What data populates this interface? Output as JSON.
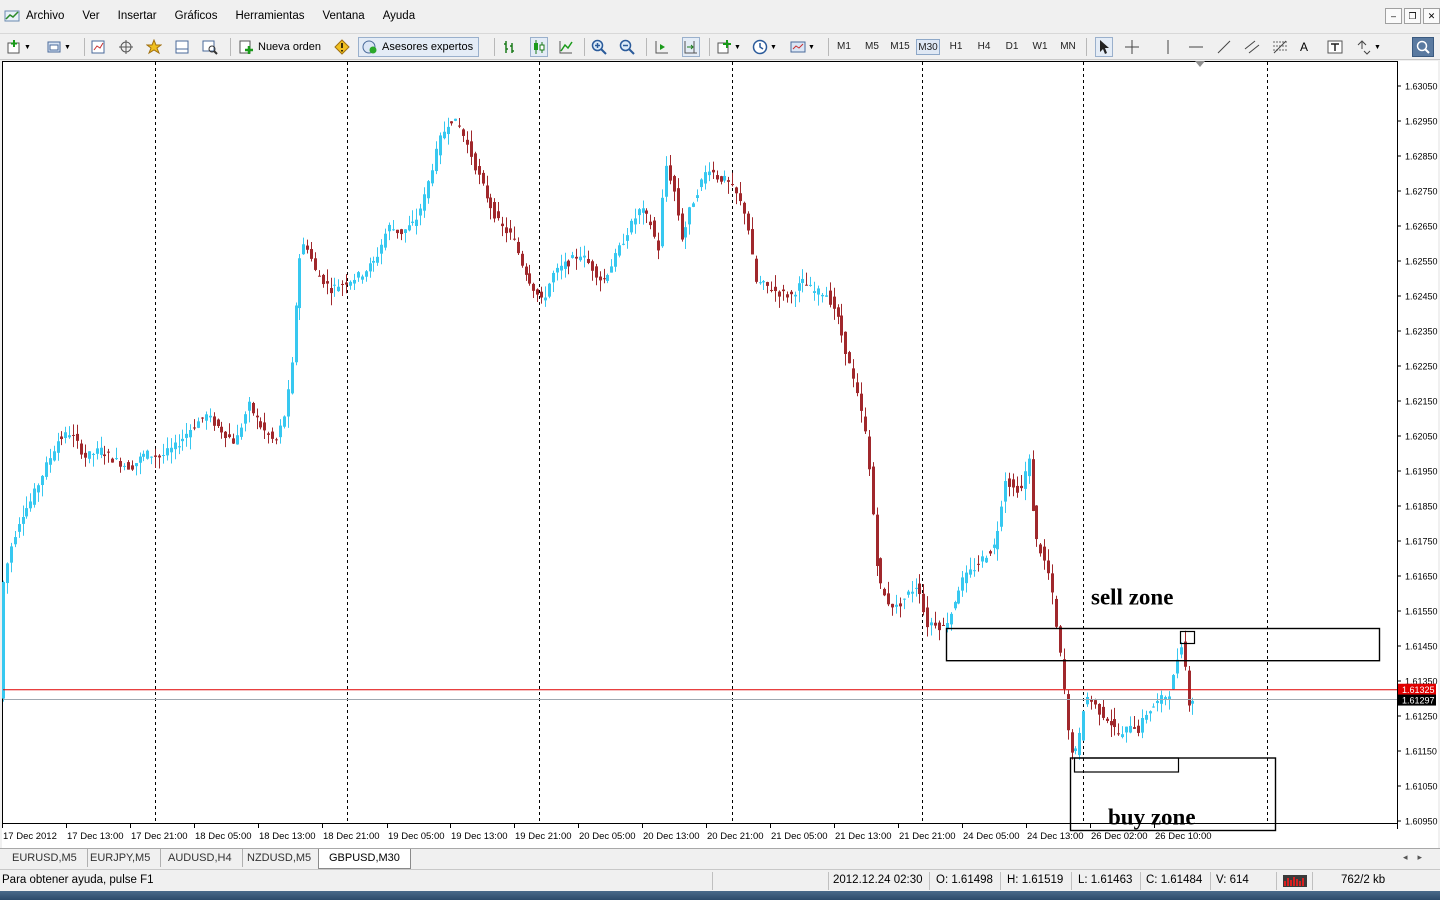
{
  "menu": {
    "items": [
      "Archivo",
      "Ver",
      "Insertar",
      "Gráficos",
      "Herramientas",
      "Ventana",
      "Ayuda"
    ]
  },
  "toolbar": {
    "new_order_label": "Nueva orden",
    "expert_advisors_label": "Asesores expertos",
    "timeframes": [
      "M1",
      "M5",
      "M15",
      "M30",
      "H1",
      "H4",
      "D1",
      "W1",
      "MN"
    ],
    "active_timeframe": "M30"
  },
  "chart_data": {
    "type": "candlestick",
    "symbol": "GBPUSD",
    "timeframe": "M30",
    "ylim": [
      1.609,
      1.6315
    ],
    "price_ticks": [
      "1.63050",
      "1.62950",
      "1.62850",
      "1.62750",
      "1.62650",
      "1.62550",
      "1.62450",
      "1.62350",
      "1.62250",
      "1.62150",
      "1.62050",
      "1.61950",
      "1.61850",
      "1.61750",
      "1.61650",
      "1.61550",
      "1.61450",
      "1.61350",
      "1.61250",
      "1.61150",
      "1.61050",
      "1.60950"
    ],
    "time_ticks": [
      "17 Dec 2012",
      "17 Dec 13:00",
      "17 Dec 21:00",
      "18 Dec 05:00",
      "18 Dec 13:00",
      "18 Dec 21:00",
      "19 Dec 05:00",
      "19 Dec 13:00",
      "19 Dec 21:00",
      "20 Dec 05:00",
      "20 Dec 13:00",
      "20 Dec 21:00",
      "21 Dec 05:00",
      "21 Dec 13:00",
      "21 Dec 21:00",
      "24 Dec 05:00",
      "24 Dec 13:00",
      "26 Dec 02:00",
      "26 Dec 10:00"
    ],
    "ask_price": "1.61325",
    "bid_price": "1.61297",
    "ask_value": 1.61325,
    "bid_value": 1.61297,
    "bullish_color": "#37c8f0",
    "bearish_color": "#a0282c",
    "ask_line_color": "#e00000",
    "bid_line_color": "#a0a8b0",
    "path": [
      [
        0,
        1.6159
      ],
      [
        10,
        1.6173
      ],
      [
        20,
        1.6182
      ],
      [
        30,
        1.6186
      ],
      [
        45,
        1.6196
      ],
      [
        58,
        1.6204
      ],
      [
        70,
        1.6206
      ],
      [
        85,
        1.6199
      ],
      [
        100,
        1.6201
      ],
      [
        115,
        1.6198
      ],
      [
        130,
        1.6196
      ],
      [
        145,
        1.62
      ],
      [
        160,
        1.6199
      ],
      [
        175,
        1.6202
      ],
      [
        190,
        1.6207
      ],
      [
        205,
        1.6211
      ],
      [
        220,
        1.6207
      ],
      [
        235,
        1.6203
      ],
      [
        248,
        1.6214
      ],
      [
        262,
        1.6207
      ],
      [
        275,
        1.6203
      ],
      [
        285,
        1.6212
      ],
      [
        292,
        1.6226
      ],
      [
        298,
        1.6255
      ],
      [
        305,
        1.6261
      ],
      [
        315,
        1.6252
      ],
      [
        330,
        1.6247
      ],
      [
        345,
        1.6249
      ],
      [
        360,
        1.6251
      ],
      [
        375,
        1.6255
      ],
      [
        388,
        1.6265
      ],
      [
        400,
        1.6263
      ],
      [
        415,
        1.6266
      ],
      [
        425,
        1.6274
      ],
      [
        432,
        1.6282
      ],
      [
        440,
        1.629
      ],
      [
        450,
        1.6296
      ],
      [
        460,
        1.6293
      ],
      [
        470,
        1.6286
      ],
      [
        480,
        1.6278
      ],
      [
        490,
        1.6271
      ],
      [
        500,
        1.6265
      ],
      [
        512,
        1.6262
      ],
      [
        522,
        1.6254
      ],
      [
        532,
        1.6248
      ],
      [
        542,
        1.6243
      ],
      [
        552,
        1.6251
      ],
      [
        565,
        1.6254
      ],
      [
        580,
        1.6257
      ],
      [
        592,
        1.6253
      ],
      [
        602,
        1.6249
      ],
      [
        615,
        1.6256
      ],
      [
        628,
        1.6264
      ],
      [
        640,
        1.627
      ],
      [
        650,
        1.6266
      ],
      [
        658,
        1.6258
      ],
      [
        665,
        1.6283
      ],
      [
        673,
        1.6276
      ],
      [
        682,
        1.6261
      ],
      [
        690,
        1.627
      ],
      [
        700,
        1.6277
      ],
      [
        708,
        1.6282
      ],
      [
        716,
        1.6279
      ],
      [
        726,
        1.6278
      ],
      [
        736,
        1.6274
      ],
      [
        746,
        1.6268
      ],
      [
        755,
        1.6249
      ],
      [
        765,
        1.6248
      ],
      [
        778,
        1.6246
      ],
      [
        790,
        1.6245
      ],
      [
        802,
        1.6249
      ],
      [
        815,
        1.6246
      ],
      [
        825,
        1.6246
      ],
      [
        835,
        1.6241
      ],
      [
        845,
        1.623
      ],
      [
        852,
        1.6222
      ],
      [
        860,
        1.6213
      ],
      [
        866,
        1.6204
      ],
      [
        872,
        1.6185
      ],
      [
        878,
        1.6164
      ],
      [
        886,
        1.6158
      ],
      [
        896,
        1.6156
      ],
      [
        908,
        1.616
      ],
      [
        918,
        1.6163
      ],
      [
        926,
        1.6151
      ],
      [
        934,
        1.6152
      ],
      [
        942,
        1.615
      ],
      [
        950,
        1.6154
      ],
      [
        960,
        1.6163
      ],
      [
        970,
        1.6166
      ],
      [
        982,
        1.617
      ],
      [
        995,
        1.6174
      ],
      [
        1005,
        1.6193
      ],
      [
        1013,
        1.619
      ],
      [
        1022,
        1.619
      ],
      [
        1028,
        1.62
      ],
      [
        1035,
        1.6176
      ],
      [
        1042,
        1.6171
      ],
      [
        1050,
        1.6164
      ],
      [
        1056,
        1.615
      ],
      [
        1062,
        1.6138
      ],
      [
        1068,
        1.6119
      ],
      [
        1074,
        1.6113
      ],
      [
        1080,
        1.612
      ],
      [
        1085,
        1.6131
      ],
      [
        1092,
        1.6129
      ],
      [
        1100,
        1.6126
      ],
      [
        1108,
        1.6124
      ],
      [
        1115,
        1.6121
      ],
      [
        1122,
        1.6119
      ],
      [
        1130,
        1.6123
      ],
      [
        1138,
        1.6121
      ],
      [
        1146,
        1.6126
      ],
      [
        1154,
        1.6128
      ],
      [
        1162,
        1.613
      ],
      [
        1170,
        1.6132
      ],
      [
        1176,
        1.614
      ],
      [
        1180,
        1.6147
      ],
      [
        1184,
        1.6141
      ],
      [
        1188,
        1.6129
      ],
      [
        1193,
        1.613
      ]
    ],
    "annotations": [
      {
        "text": "sell zone",
        "price_top": 1.615,
        "price_bottom": 1.61408
      },
      {
        "text": "buy zone",
        "price_top": 1.6113,
        "price_bottom": 1.6098
      }
    ]
  },
  "tabs": {
    "items": [
      "EURUSD,M5",
      "EURJPY,M5",
      "AUDUSD,H4",
      "NZDUSD,M5",
      "GBPUSD,M30"
    ],
    "active": "GBPUSD,M30"
  },
  "status": {
    "help_text": "Para obtener ayuda, pulse F1",
    "datetime": "2012.12.24 02:30",
    "open": "O: 1.61498",
    "high": "H: 1.61519",
    "low": "L: 1.61463",
    "close": "C: 1.61484",
    "volume": "V: 614",
    "traffic": "762/2 kb"
  }
}
